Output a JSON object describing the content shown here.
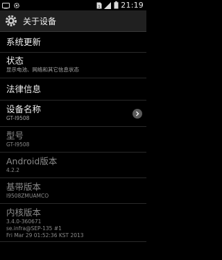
{
  "status_bar": {
    "time": "21:19",
    "icons": [
      "tv-icon",
      "settings-gear-icon",
      "sim-icon",
      "signal-icon",
      "battery-icon"
    ]
  },
  "action_bar": {
    "icon": "settings-gear-icon",
    "title": "关于设备"
  },
  "items": [
    {
      "title": "系统更新"
    },
    {
      "title": "状态",
      "subtitle": "显示电池、网络和其它信息状态"
    },
    {
      "title": "法律信息"
    },
    {
      "title": "设备名称",
      "subtitle": "GT-I9508"
    },
    {
      "title": "型号",
      "subtitle": "GT-I9508"
    },
    {
      "title": "Android版本",
      "subtitle": "4.2.2"
    },
    {
      "title": "基带版本",
      "subtitle": "I9508ZMUAMCO"
    },
    {
      "title": "内核版本",
      "subtitle_lines": [
        "3.4.0-360671",
        "se.infra@SEP-135 #1",
        "Fri Mar 29 01:52:36 KST 2013"
      ]
    }
  ],
  "colors": {
    "background": "#000000",
    "action_bar": "#202020",
    "divider": "#2a2a2a",
    "dim_text": "#8a8a8a"
  }
}
